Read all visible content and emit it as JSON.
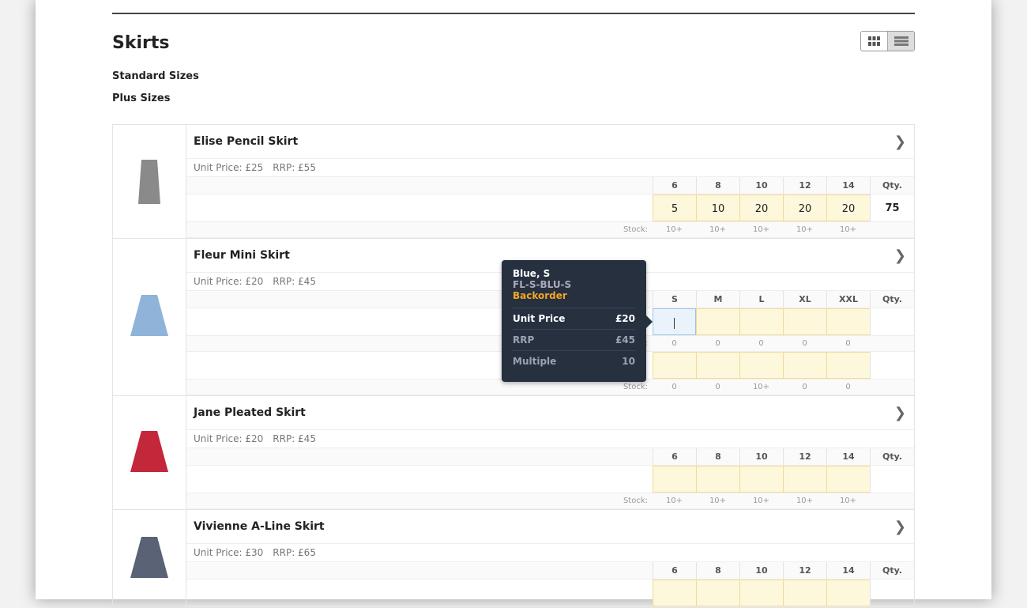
{
  "page": {
    "title": "Skirts",
    "categories": [
      "Standard Sizes",
      "Plus Sizes"
    ]
  },
  "view_toggle": {
    "grid": "grid-icon",
    "list": "list-icon"
  },
  "stock_label": "Stock:",
  "qty_label": "Qty.",
  "products": [
    {
      "name": "Elise Pencil Skirt",
      "unit_price": "Unit Price: £25",
      "rrp": "RRP: £55",
      "image_color": "#8a8a8a",
      "grids": [
        {
          "sizes": [
            "6",
            "8",
            "10",
            "12",
            "14"
          ],
          "values": [
            "5",
            "10",
            "20",
            "20",
            "20"
          ],
          "qty": "75",
          "stock": [
            "10+",
            "10+",
            "10+",
            "10+",
            "10+"
          ]
        }
      ]
    },
    {
      "name": "Fleur Mini Skirt",
      "unit_price": "Unit Price: £20",
      "rrp": "RRP: £45",
      "image_color": "#8fb3d9",
      "grids": [
        {
          "sizes": [
            "S",
            "M",
            "L",
            "XL",
            "XXL"
          ],
          "values": [
            "",
            "",
            "",
            "",
            ""
          ],
          "qty": "",
          "stock": [
            "0",
            "0",
            "0",
            "0",
            "0"
          ]
        },
        {
          "values": [
            "",
            "",
            "",
            "",
            ""
          ],
          "qty": "",
          "stock": [
            "0",
            "0",
            "10+",
            "0",
            "0"
          ]
        }
      ]
    },
    {
      "name": "Jane Pleated Skirt",
      "unit_price": "Unit Price: £20",
      "rrp": "RRP: £45",
      "image_color": "#c2283a",
      "grids": [
        {
          "sizes": [
            "6",
            "8",
            "10",
            "12",
            "14"
          ],
          "values": [
            "",
            "",
            "",
            "",
            ""
          ],
          "qty": "",
          "stock": [
            "10+",
            "10+",
            "10+",
            "10+",
            "10+"
          ]
        }
      ]
    },
    {
      "name": "Vivienne A-Line Skirt",
      "unit_price": "Unit Price: £30",
      "rrp": "RRP: £65",
      "image_color": "#5a6275",
      "grids": [
        {
          "sizes": [
            "6",
            "8",
            "10",
            "12",
            "14"
          ],
          "values": [
            "",
            "",
            "",
            "",
            ""
          ],
          "qty": "",
          "stock": []
        }
      ]
    }
  ],
  "tooltip": {
    "variant": "Blue, S",
    "sku": "FL-S-BLU-S",
    "status": "Backorder",
    "rows": [
      {
        "label": "Unit Price",
        "value": "£20"
      },
      {
        "label": "RRP",
        "value": "£45"
      },
      {
        "label": "Multiple",
        "value": "10"
      }
    ]
  }
}
